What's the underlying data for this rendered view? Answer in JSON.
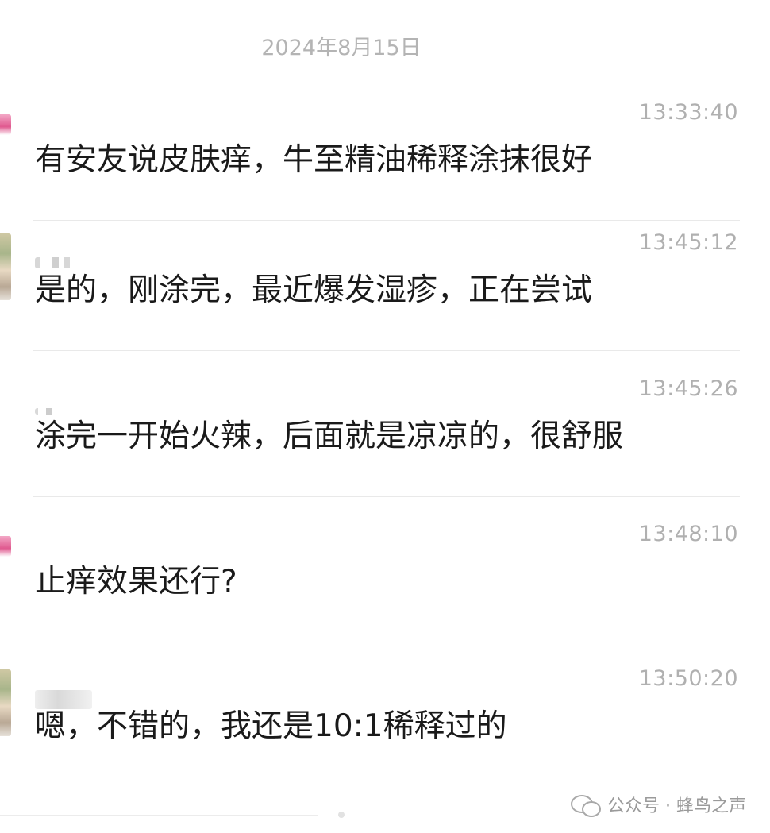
{
  "date_separator": "2024年8月15日",
  "messages": [
    {
      "time": "13:33:40",
      "text": "有安友说皮肤痒，牛至精油稀释涂抹很好"
    },
    {
      "time": "13:45:12",
      "text": "是的，刚涂完，最近爆发湿疹，正在尝试"
    },
    {
      "time": "13:45:26",
      "text": "涂完一开始火辣，后面就是凉凉的，很舒服"
    },
    {
      "time": "13:48:10",
      "text": "止痒效果还行?"
    },
    {
      "time": "13:50:20",
      "text": "嗯，不错的，我还是10:1稀释过的"
    }
  ],
  "watermark": {
    "icon": "wechat-icon",
    "text": "公众号 · 蜂鸟之声"
  }
}
